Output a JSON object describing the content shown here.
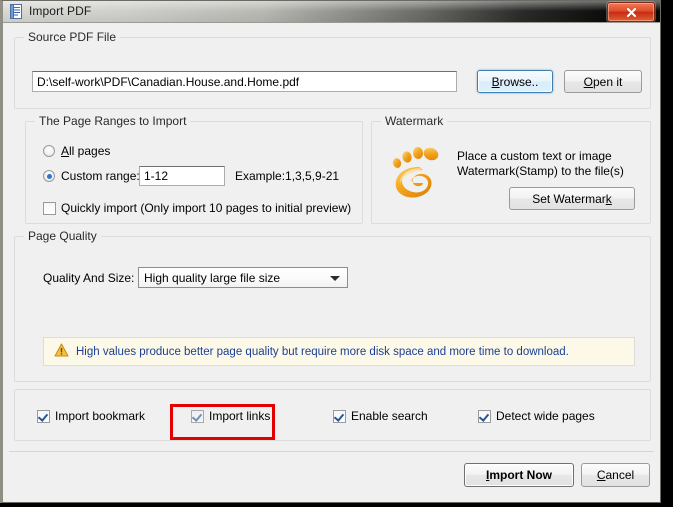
{
  "window": {
    "title": "Import PDF",
    "app_icon": "pdf-document-icon",
    "close_label": "×"
  },
  "source_group": {
    "legend": "Source PDF File",
    "path_value": "D:\\self-work\\PDF\\Canadian.House.and.Home.pdf",
    "path_placeholder": "",
    "browse_label": "Browse..",
    "browse_accel": "B",
    "open_label": "Open it",
    "open_accel": "O"
  },
  "page_ranges_group": {
    "legend": "The Page Ranges to Import",
    "all_pages_label": "All pages",
    "all_pages_accel": "A",
    "all_pages_checked": false,
    "custom_range_label": "Custom range:",
    "custom_range_checked": true,
    "custom_range_value": "1-12",
    "example_text": "Example:1,3,5,9-21",
    "quick_import_label": "Quickly import (Only import 10 pages to  initial  preview)",
    "quick_import_checked": false
  },
  "watermark_group": {
    "legend": "Watermark",
    "icon": "gnome-foot-icon",
    "description": "Place a custom text or image\nWatermark(Stamp) to the file(s)",
    "button_label": "Set Watermark",
    "button_accel": "k"
  },
  "page_quality_group": {
    "legend": "Page Quality",
    "quality_label": "Quality And Size:",
    "quality_value": "High quality large file size",
    "quality_options": [
      "High quality large file size"
    ],
    "warning_icon": "warning-triangle-icon",
    "warning_text": "High values produce better page quality but require more disk space and more time to download."
  },
  "options_group": {
    "items": [
      {
        "label": "Import bookmark",
        "checked": true,
        "muted": false,
        "highlighted": false
      },
      {
        "label": "Import links",
        "checked": true,
        "muted": true,
        "highlighted": true
      },
      {
        "label": "Enable search",
        "checked": true,
        "muted": false,
        "highlighted": false
      },
      {
        "label": "Detect wide pages",
        "checked": true,
        "muted": false,
        "highlighted": false
      }
    ]
  },
  "footer": {
    "import_label": "Import Now",
    "import_accel": "I",
    "cancel_label": "Cancel",
    "cancel_accel": "C"
  },
  "colors": {
    "accent_blue": "#2c76c8",
    "highlight_red": "#e20000",
    "warning_bg": "#fdf9e8",
    "info_text": "#1c3f94",
    "watermark_orange": "#f0a41e",
    "close_red": "#c62c12"
  }
}
